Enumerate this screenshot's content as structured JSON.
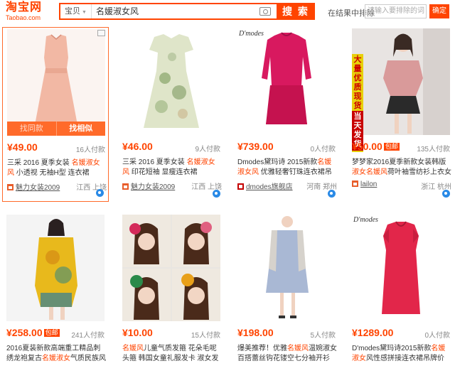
{
  "header": {
    "logo_main": "淘宝网",
    "logo_sub": "Taobao.com",
    "search_scope": "宝贝",
    "search_query": "名媛淑女风",
    "search_button": "搜 索",
    "within_label": "在结果中排除",
    "within_placeholder": "请输入要排除的词",
    "within_button": "确定"
  },
  "overlay": {
    "same_label": "找同款",
    "similar_label": "找相似"
  },
  "banner": {
    "top": "大量优质现货",
    "bottom": "当天发货"
  },
  "products": [
    {
      "price": "¥49.00",
      "badge": "",
      "sales": "16人付款",
      "title_pre": "三采 2016 夏季女装 ",
      "title_kw": "名媛淑女风",
      "title_post": " 小透视 无袖H型 连衣裙 S2311L22",
      "shop": "魅力女装2009",
      "location": "江西 上饶"
    },
    {
      "price": "¥46.00",
      "badge": "",
      "sales": "9人付款",
      "title_pre": "三采 2016 夏季女装 ",
      "title_kw": "名媛淑女风",
      "title_post": " 印花短袖 显瘦连衣裙 S2551L18",
      "shop": "魅力女装2009",
      "location": "江西 上饶"
    },
    {
      "price": "¥739.00",
      "badge": "",
      "sales": "0人付款",
      "title_pre": "Dmodes黛玛诗 2015新款",
      "title_kw": "名媛淑女风",
      "title_post": " 优雅轻奢钉珠连衣裙吊牌价3680",
      "shop": "dmodes旗舰店",
      "location": "河南 郑州"
    },
    {
      "price": "¥50.00",
      "badge": "包邮",
      "sales": "135人付款",
      "title_pre": "梦梦家2016夏季新款女装韩版",
      "title_kw": "淑女名媛风",
      "title_post": "荷叶袖雪纺衫上衣女",
      "shop": "lailon",
      "location": "浙江 杭州"
    },
    {
      "price": "¥258.00",
      "badge": "包邮",
      "sales": "241人付款",
      "title_pre": "2016夏装新款高端重工精品刺绣龙袍复古",
      "title_kw": "名媛淑女",
      "title_post": "气质民族风连衣裙",
      "shop": "",
      "location": ""
    },
    {
      "price": "¥10.00",
      "badge": "",
      "sales": "15人付款",
      "title_pre": "",
      "title_kw": "名媛风",
      "title_post": "儿童气质发箍 花朵毛呢头箍 韩国女童礼服发卡 淑女发饰",
      "shop": "",
      "location": ""
    },
    {
      "price": "¥198.00",
      "badge": "",
      "sales": "5人付款",
      "title_pre": "爆美推荐！优雅",
      "title_kw": "名媛风",
      "title_post": "温婉淑女百搭蕾丝钩花镂空七分袖开衫",
      "shop": "",
      "location": ""
    },
    {
      "price": "¥1289.00",
      "badge": "",
      "sales": "0人付款",
      "title_pre": "D'modes黛玛诗2015新款",
      "title_kw": "名媛淑女",
      "title_post": "风性感拼接连衣裙吊牌价4280",
      "shop": "",
      "location": ""
    }
  ],
  "brand_tag": "D'modes",
  "colors": {
    "accent": "#ff4400",
    "wangwang": "#2a8ae6"
  }
}
